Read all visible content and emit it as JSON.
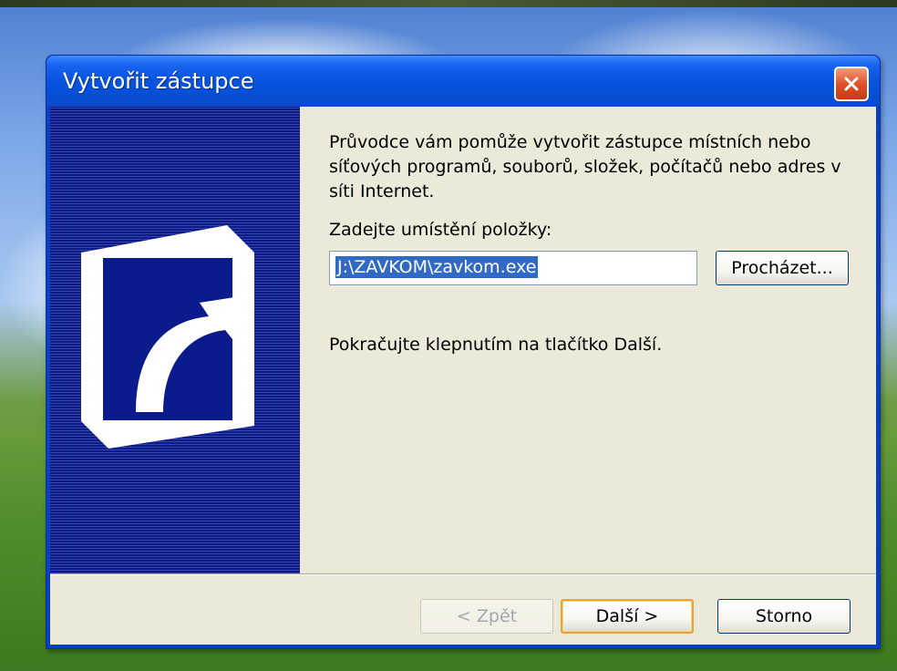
{
  "window": {
    "title": "Vytvořit zástupce",
    "close_icon": "close-icon"
  },
  "wizard": {
    "description": "Průvodce vám pomůže vytvořit zástupce místních nebo síťových programů, souborů, složek, počítačů nebo adres v síti Internet.",
    "location_label": "Zadejte umístění položky:",
    "location_value": "J:\\ZAVKOM\\zavkom.exe",
    "browse_label": "Procházet...",
    "hint": "Pokračujte klepnutím na tlačítko Další."
  },
  "buttons": {
    "back_label": "< Zpět",
    "next_label": "Další >",
    "cancel_label": "Storno"
  },
  "sidebar_icon": "shortcut-arrow-icon",
  "colors": {
    "title_bar": "#0a55e0",
    "sidebar": "#0b1b8c",
    "dialog_bg": "#ece9d8",
    "selection": "#316ac5",
    "close_button": "#e3502a"
  }
}
